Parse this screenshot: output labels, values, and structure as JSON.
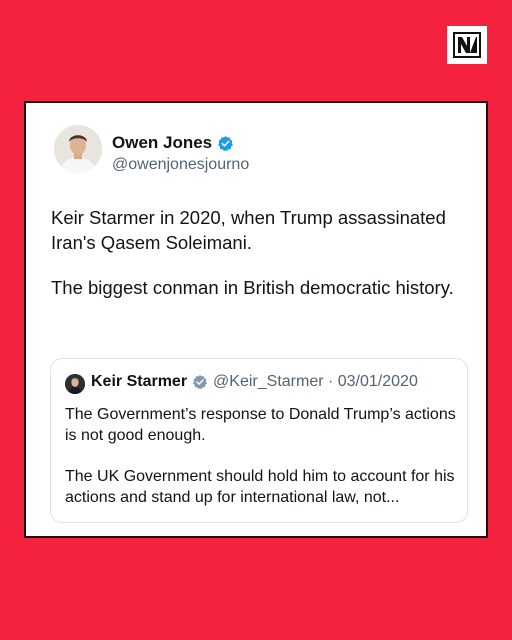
{
  "brand": {
    "logo_icon": "novara-media-logo-icon"
  },
  "post": {
    "author": {
      "name": "Owen Jones",
      "handle": "@owenjonesjourno",
      "verified_icon": "verified-badge-icon",
      "verified_color": "#1d9bf0"
    },
    "paragraphs": [
      "Keir Starmer in 2020, when Trump assassinated Iran's Qasem Soleimani.",
      "The biggest conman in British democratic history."
    ],
    "quoted": {
      "author_name": "Keir Starmer",
      "verified_icon": "verified-badge-grey-icon",
      "verified_color": "#829aab",
      "handle_date": "@Keir_Starmer · 03/01/2020",
      "paragraphs": [
        "The Government’s response to Donald Trump’s actions is not good enough.",
        "The UK Government should hold him to account for his actions and stand up for international law, not..."
      ]
    }
  },
  "colors": {
    "background": "#f4213f",
    "card": "#ffffff",
    "text": "#0f1419",
    "muted": "#536471"
  }
}
